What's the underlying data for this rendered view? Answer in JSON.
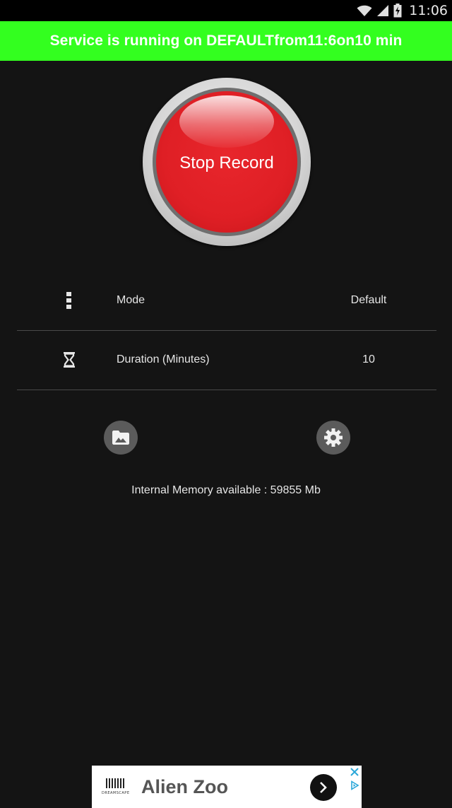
{
  "status_bar": {
    "time": "11:06",
    "icons": [
      "wifi-icon",
      "signal-icon",
      "battery-icon"
    ]
  },
  "banner": {
    "text": "Service is running on DEFAULTfrom11:6on10 min",
    "color": "#33ff1f"
  },
  "record_button": {
    "label": "Stop Record",
    "color": "#df1f25"
  },
  "settings": {
    "mode": {
      "icon": "more-vert-icon",
      "label": "Mode",
      "value": "Default"
    },
    "duration": {
      "icon": "hourglass-icon",
      "label": "Duration (Minutes)",
      "value": "10"
    }
  },
  "actions": {
    "gallery_icon": "image-folder-icon",
    "settings_icon": "gear-icon"
  },
  "memory": {
    "text": "Internal Memory available : 59855 Mb"
  },
  "ad": {
    "title": "Alien Zoo",
    "logo_text": "DREAMSCAPE",
    "icons": [
      "arrow-right-icon",
      "close-icon",
      "adchoices-icon"
    ]
  }
}
